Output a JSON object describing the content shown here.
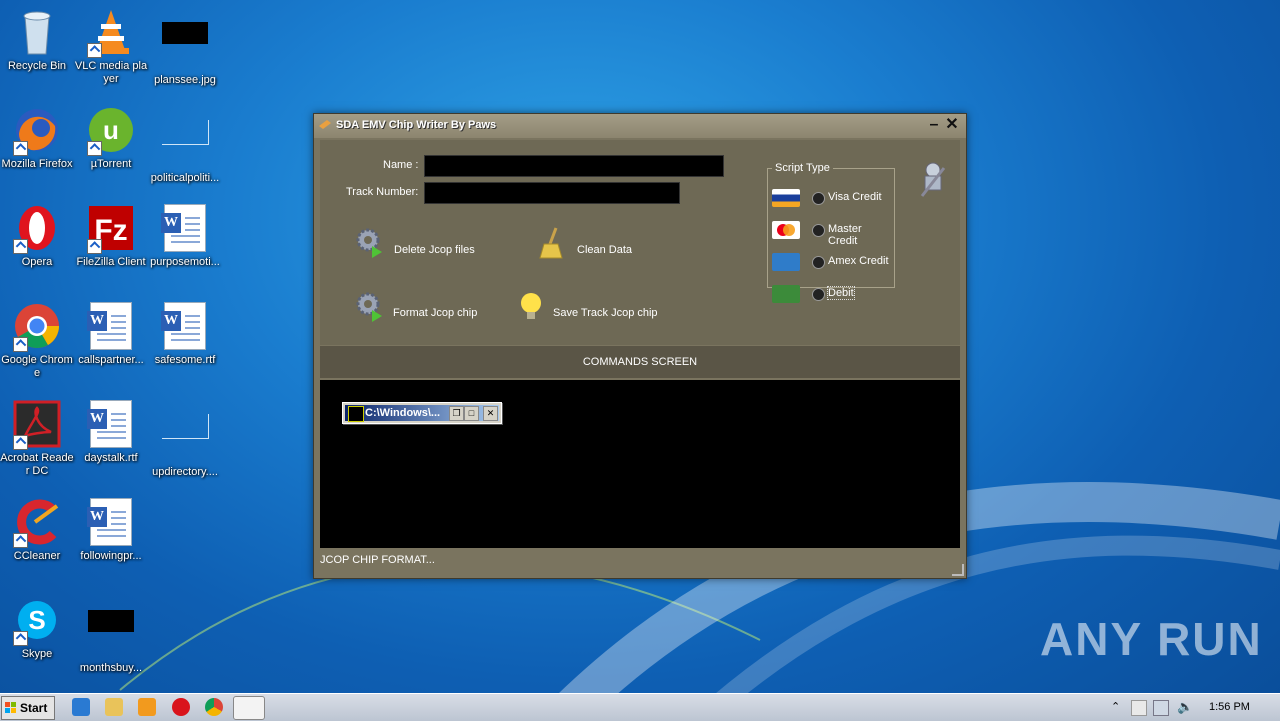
{
  "desktop": {
    "icons": [
      {
        "label": "Recycle Bin"
      },
      {
        "label": "VLC media player"
      },
      {
        "label": "planssee.jpg"
      },
      {
        "label": "Mozilla Firefox"
      },
      {
        "label": "µTorrent"
      },
      {
        "label": "politicalpoliti..."
      },
      {
        "label": "Opera"
      },
      {
        "label": "FileZilla Client"
      },
      {
        "label": "purposemoti..."
      },
      {
        "label": "Google Chrome"
      },
      {
        "label": "callspartner..."
      },
      {
        "label": "safesome.rtf"
      },
      {
        "label": "Acrobat Reader DC"
      },
      {
        "label": "daystalk.rtf"
      },
      {
        "label": "updirectory...."
      },
      {
        "label": "CCleaner"
      },
      {
        "label": "followingpr..."
      },
      {
        "label": "Skype"
      },
      {
        "label": "monthsbuy..."
      }
    ]
  },
  "app": {
    "title": "SDA EMV Chip Writer  By Paws",
    "name_label": "Name :",
    "name_value": "",
    "track_label": "Track Number:",
    "track_value": "",
    "buttons": {
      "delete": "Delete Jcop files",
      "clean": "Clean Data",
      "format": "Format Jcop chip",
      "save": "Save Track Jcop chip"
    },
    "script_type": {
      "legend": "Script Type",
      "options": [
        "Visa Credit",
        "Master Credit",
        "Amex Credit",
        "Debit"
      ]
    },
    "commands_screen": "COMMANDS SCREEN",
    "status": "JCOP CHIP FORMAT..."
  },
  "console": {
    "title": "C:\\Windows\\..."
  },
  "watermark": "ANY RUN",
  "taskbar": {
    "start": "Start",
    "clock": "1:56 PM"
  },
  "colors": {
    "window_bg": "#7a745f",
    "desktop": "#1a7dcf"
  }
}
